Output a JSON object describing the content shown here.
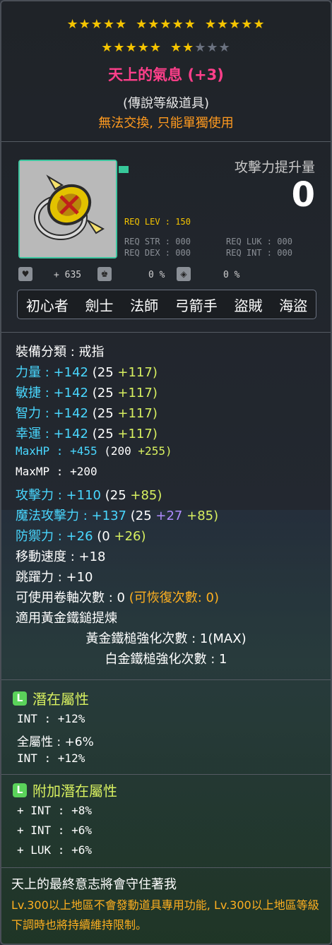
{
  "header": {
    "star_row1_groups": [
      5,
      5,
      5
    ],
    "star_row2": {
      "filled_first": 5,
      "filled_second": 2,
      "empty": 3
    },
    "title": "天上的氣息 (+3)",
    "grade": "(傳說等級道具)",
    "trade_note": "無法交換, 只能單獨使用"
  },
  "attack_boost": {
    "label": "攻擊力提升量",
    "value": "0"
  },
  "requirements": {
    "lev": "REQ LEV : 150",
    "str": "REQ STR : 000",
    "luk": "REQ LUK : 000",
    "dex": "REQ DEX : 000",
    "int": "REQ INT : 000"
  },
  "small_stats": {
    "plus": "+ 635",
    "pct1": "0 %",
    "pct2": "0 %"
  },
  "jobs": [
    "初心者",
    "劍士",
    "法師",
    "弓箭手",
    "盜賊",
    "海盜"
  ],
  "stats": {
    "category_label": "裝備分類 : 戒指",
    "str": {
      "name": "力量 :",
      "total": "+142",
      "base": "(25",
      "bonus": "+117)"
    },
    "dex": {
      "name": "敏捷 :",
      "total": "+142",
      "base": "(25",
      "bonus": "+117)"
    },
    "int": {
      "name": "智力 :",
      "total": "+142",
      "base": "(25",
      "bonus": "+117)"
    },
    "luk": {
      "name": "幸運 :",
      "total": "+142",
      "base": "(25",
      "bonus": "+117)"
    },
    "maxhp": {
      "name": "MaxHP :",
      "total": "+455",
      "base": "(200",
      "bonus": "+255)"
    },
    "maxmp": "MaxMP : +200",
    "atk": {
      "name": "攻擊力 :",
      "total": "+110",
      "base": "(25",
      "bonus": "+85)"
    },
    "matk": {
      "name": "魔法攻擊力 :",
      "total": "+137",
      "base": "(25",
      "extra": "+27",
      "bonus": "+85)"
    },
    "def": {
      "name": "防禦力 :",
      "total": "+26",
      "base": "(0",
      "bonus": "+26)"
    },
    "speed": "移動速度 : +18",
    "jump": "跳躍力 : +10",
    "scroll": "可使用卷軸次數 : 0",
    "scroll_recover": "(可恢復次數: 0)",
    "hammer": "適用黃金鐵鎚提煉",
    "gold_hammer": "黃金鐵槌強化次數 : 1(MAX)",
    "plat_hammer": "白金鐵槌強化次數 : 1"
  },
  "potential": {
    "title": "潛在屬性",
    "grade_letter": "L",
    "lines": [
      "INT : +12%",
      "全屬性 : +6%",
      "INT : +12%"
    ]
  },
  "additional_potential": {
    "title": "附加潛在屬性",
    "grade_letter": "L",
    "lines": [
      "+ INT : +8%",
      "+ INT : +6%",
      "+ LUK : +6%"
    ]
  },
  "description": {
    "line1": "天上的最終意志將會守住著我",
    "line2": "Lv.300以上地區不會發動道具專用功能, Lv.300以上地區等級下調時也將持續維持限制。"
  },
  "colors": {
    "title": "#ff3f8a",
    "trade": "#ff9a1f",
    "stat_name": "#49d7ff",
    "bonus": "#d8f060",
    "pot_title": "#d8f060"
  }
}
